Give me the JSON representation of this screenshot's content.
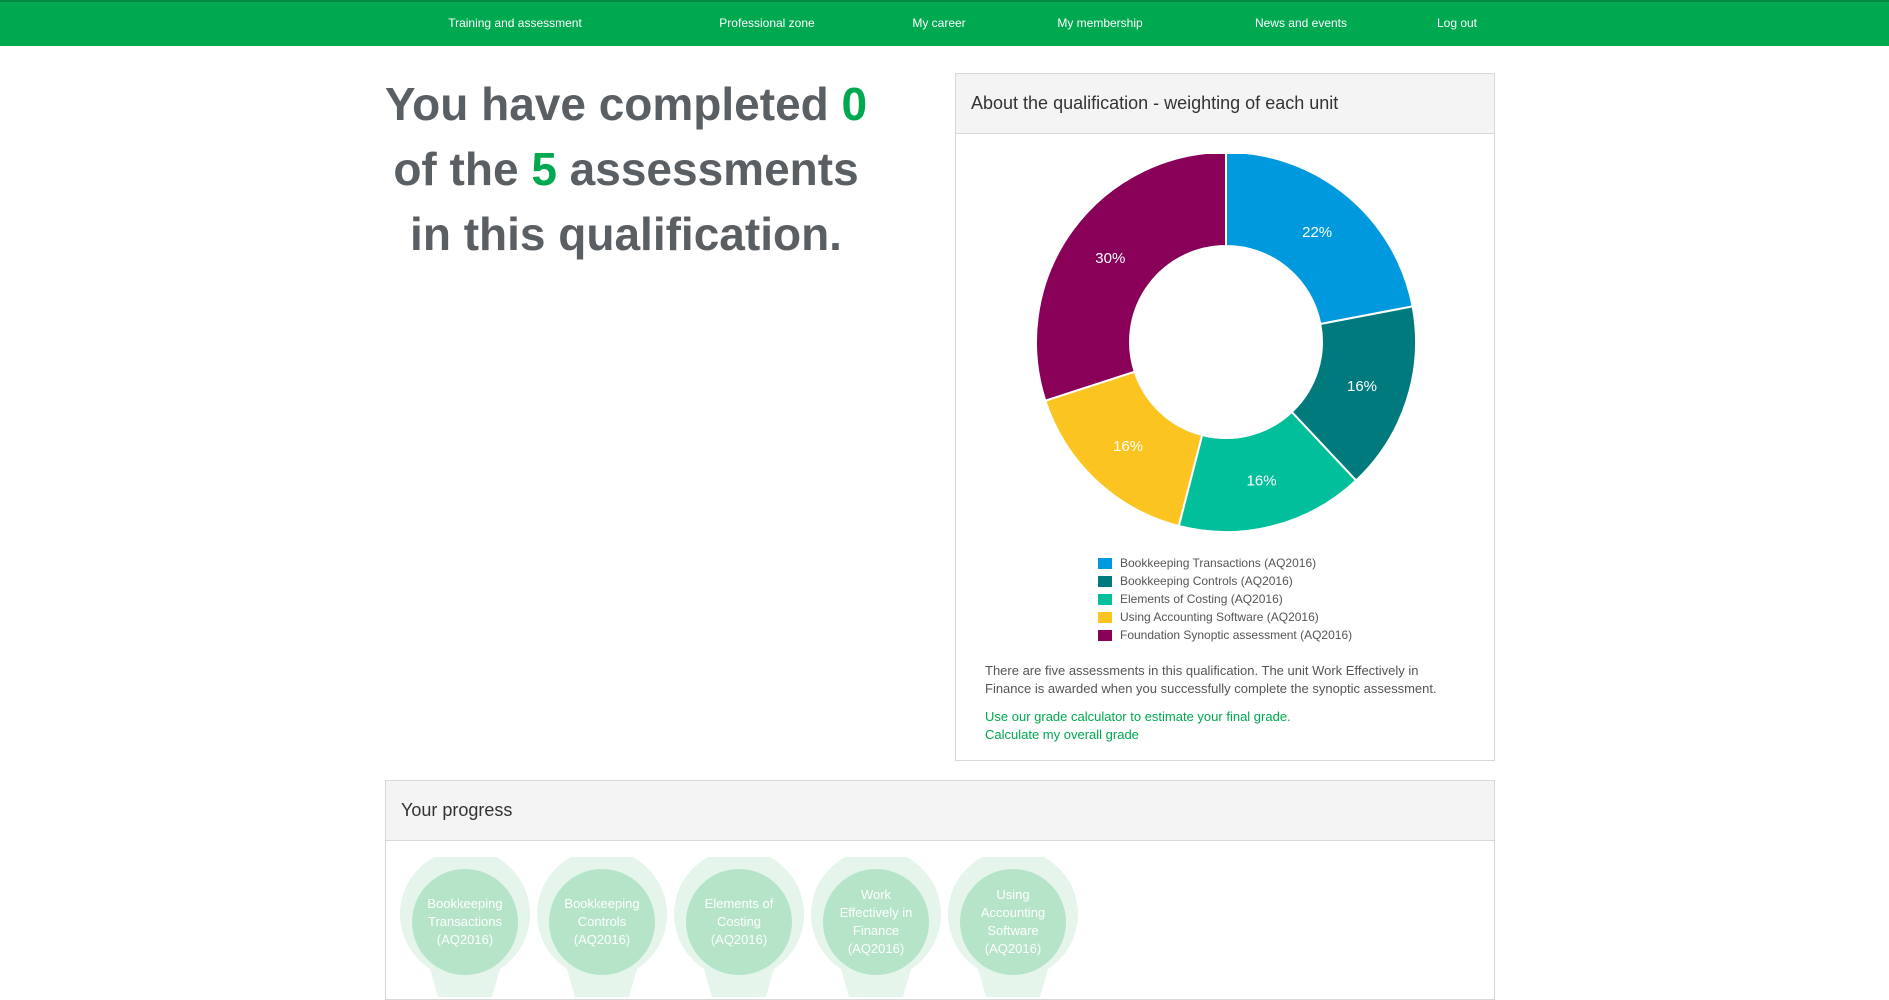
{
  "nav": [
    "Training and assessment",
    "Professional zone",
    "My career",
    "My membership",
    "News and events",
    "Log out"
  ],
  "headline": {
    "part1": "You have completed ",
    "completed": "0",
    "part2": "of the ",
    "total": "5",
    "part3": " assessments",
    "part4": "in this qualification."
  },
  "qualification_panel": {
    "title": "About the qualification - weighting of each unit",
    "note": "There are five assessments in this qualification. The unit Work Effectively in Finance is awarded when you successfully complete the synoptic assessment.",
    "links": [
      "Use our grade calculator to estimate your final grade.",
      "Calculate my overall grade"
    ]
  },
  "chart_data": {
    "type": "pie",
    "donut": true,
    "title": "",
    "legend_position": "bottom",
    "categories": [
      "Bookkeeping Transactions (AQ2016)",
      "Bookkeeping Controls (AQ2016)",
      "Elements of Costing (AQ2016)",
      "Using Accounting Software (AQ2016)",
      "Foundation Synoptic assessment (AQ2016)"
    ],
    "values": [
      22,
      16,
      16,
      16,
      30
    ],
    "labels": [
      "22%",
      "16%",
      "16%",
      "16%",
      "30%"
    ],
    "colors": [
      "#0099dd",
      "#007a7c",
      "#00bf9a",
      "#fcc420",
      "#880058"
    ]
  },
  "progress_panel": {
    "title": "Your progress",
    "units": [
      [
        "Bookkeeping",
        "Transactions",
        "(AQ2016)"
      ],
      [
        "Bookkeeping",
        "Controls",
        "(AQ2016)"
      ],
      [
        "Elements of",
        "Costing",
        "(AQ2016)"
      ],
      [
        "Work",
        "Effectively in",
        "Finance",
        "(AQ2016)"
      ],
      [
        "Using",
        "Accounting",
        "Software",
        "(AQ2016)"
      ]
    ],
    "badge_colors": {
      "outer": "#e5f5ec",
      "inner": "#b5e4c9"
    }
  }
}
